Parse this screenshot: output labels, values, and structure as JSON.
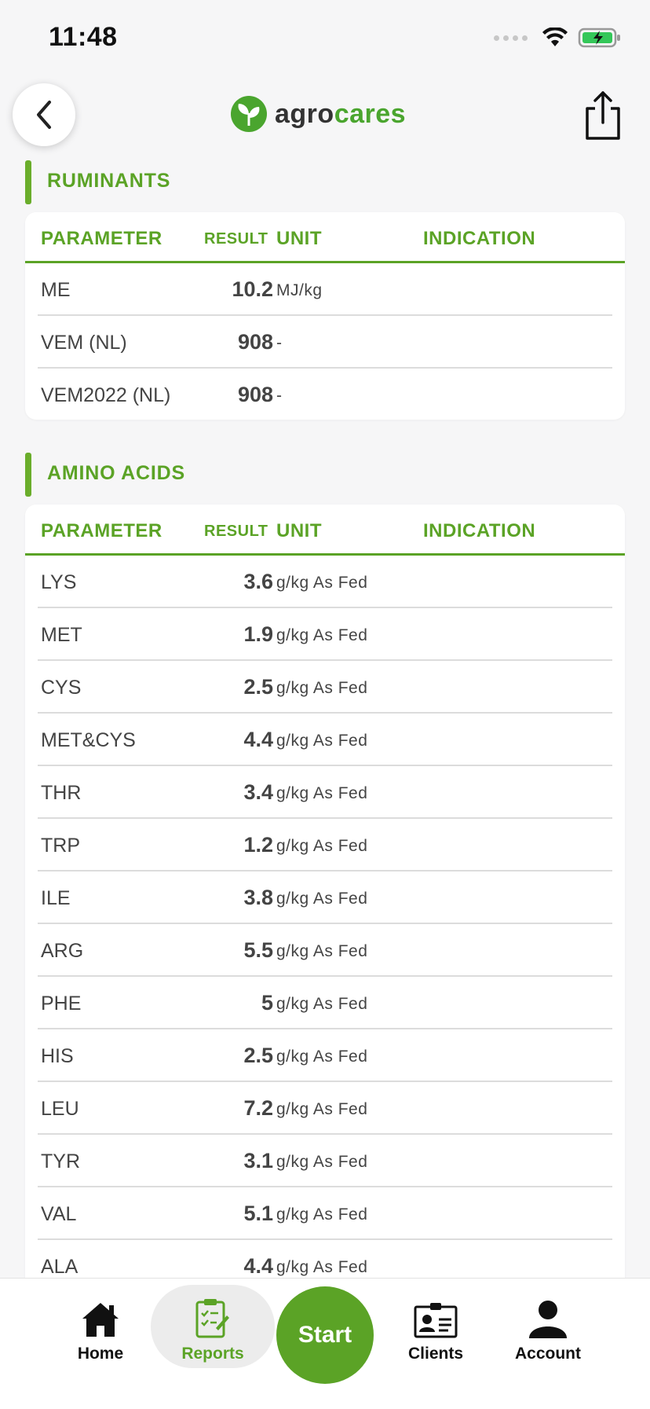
{
  "status": {
    "time": "11:48"
  },
  "header": {
    "brand_part1": "agro",
    "brand_part2": "cares"
  },
  "colors": {
    "accent": "#5ba326",
    "background": "#f6f6f7",
    "text": "#444444"
  },
  "table_headers": {
    "parameter": "PARAMETER",
    "result": "RESULT",
    "unit": "UNIT",
    "indication": "INDICATION"
  },
  "sections": [
    {
      "title": "RUMINANTS",
      "rows": [
        {
          "parameter": "ME",
          "result": "10.2",
          "unit": "MJ/kg"
        },
        {
          "parameter": "VEM (NL)",
          "result": "908",
          "unit": "-"
        },
        {
          "parameter": "VEM2022 (NL)",
          "result": "908",
          "unit": "-"
        }
      ]
    },
    {
      "title": "AMINO ACIDS",
      "rows": [
        {
          "parameter": "LYS",
          "result": "3.6",
          "unit": "g/kg As Fed"
        },
        {
          "parameter": "MET",
          "result": "1.9",
          "unit": "g/kg As Fed"
        },
        {
          "parameter": "CYS",
          "result": "2.5",
          "unit": "g/kg As Fed"
        },
        {
          "parameter": "MET&CYS",
          "result": "4.4",
          "unit": "g/kg As Fed"
        },
        {
          "parameter": "THR",
          "result": "3.4",
          "unit": "g/kg As Fed"
        },
        {
          "parameter": "TRP",
          "result": "1.2",
          "unit": "g/kg As Fed"
        },
        {
          "parameter": "ILE",
          "result": "3.8",
          "unit": "g/kg As Fed"
        },
        {
          "parameter": "ARG",
          "result": "5.5",
          "unit": "g/kg As Fed"
        },
        {
          "parameter": "PHE",
          "result": "5",
          "unit": "g/kg As Fed"
        },
        {
          "parameter": "HIS",
          "result": "2.5",
          "unit": "g/kg As Fed"
        },
        {
          "parameter": "LEU",
          "result": "7.2",
          "unit": "g/kg As Fed"
        },
        {
          "parameter": "TYR",
          "result": "3.1",
          "unit": "g/kg As Fed"
        },
        {
          "parameter": "VAL",
          "result": "5.1",
          "unit": "g/kg As Fed"
        },
        {
          "parameter": "ALA",
          "result": "4.4",
          "unit": "g/kg As Fed"
        }
      ]
    }
  ],
  "tabbar": {
    "home": "Home",
    "reports": "Reports",
    "start": "Start",
    "clients": "Clients",
    "account": "Account"
  }
}
